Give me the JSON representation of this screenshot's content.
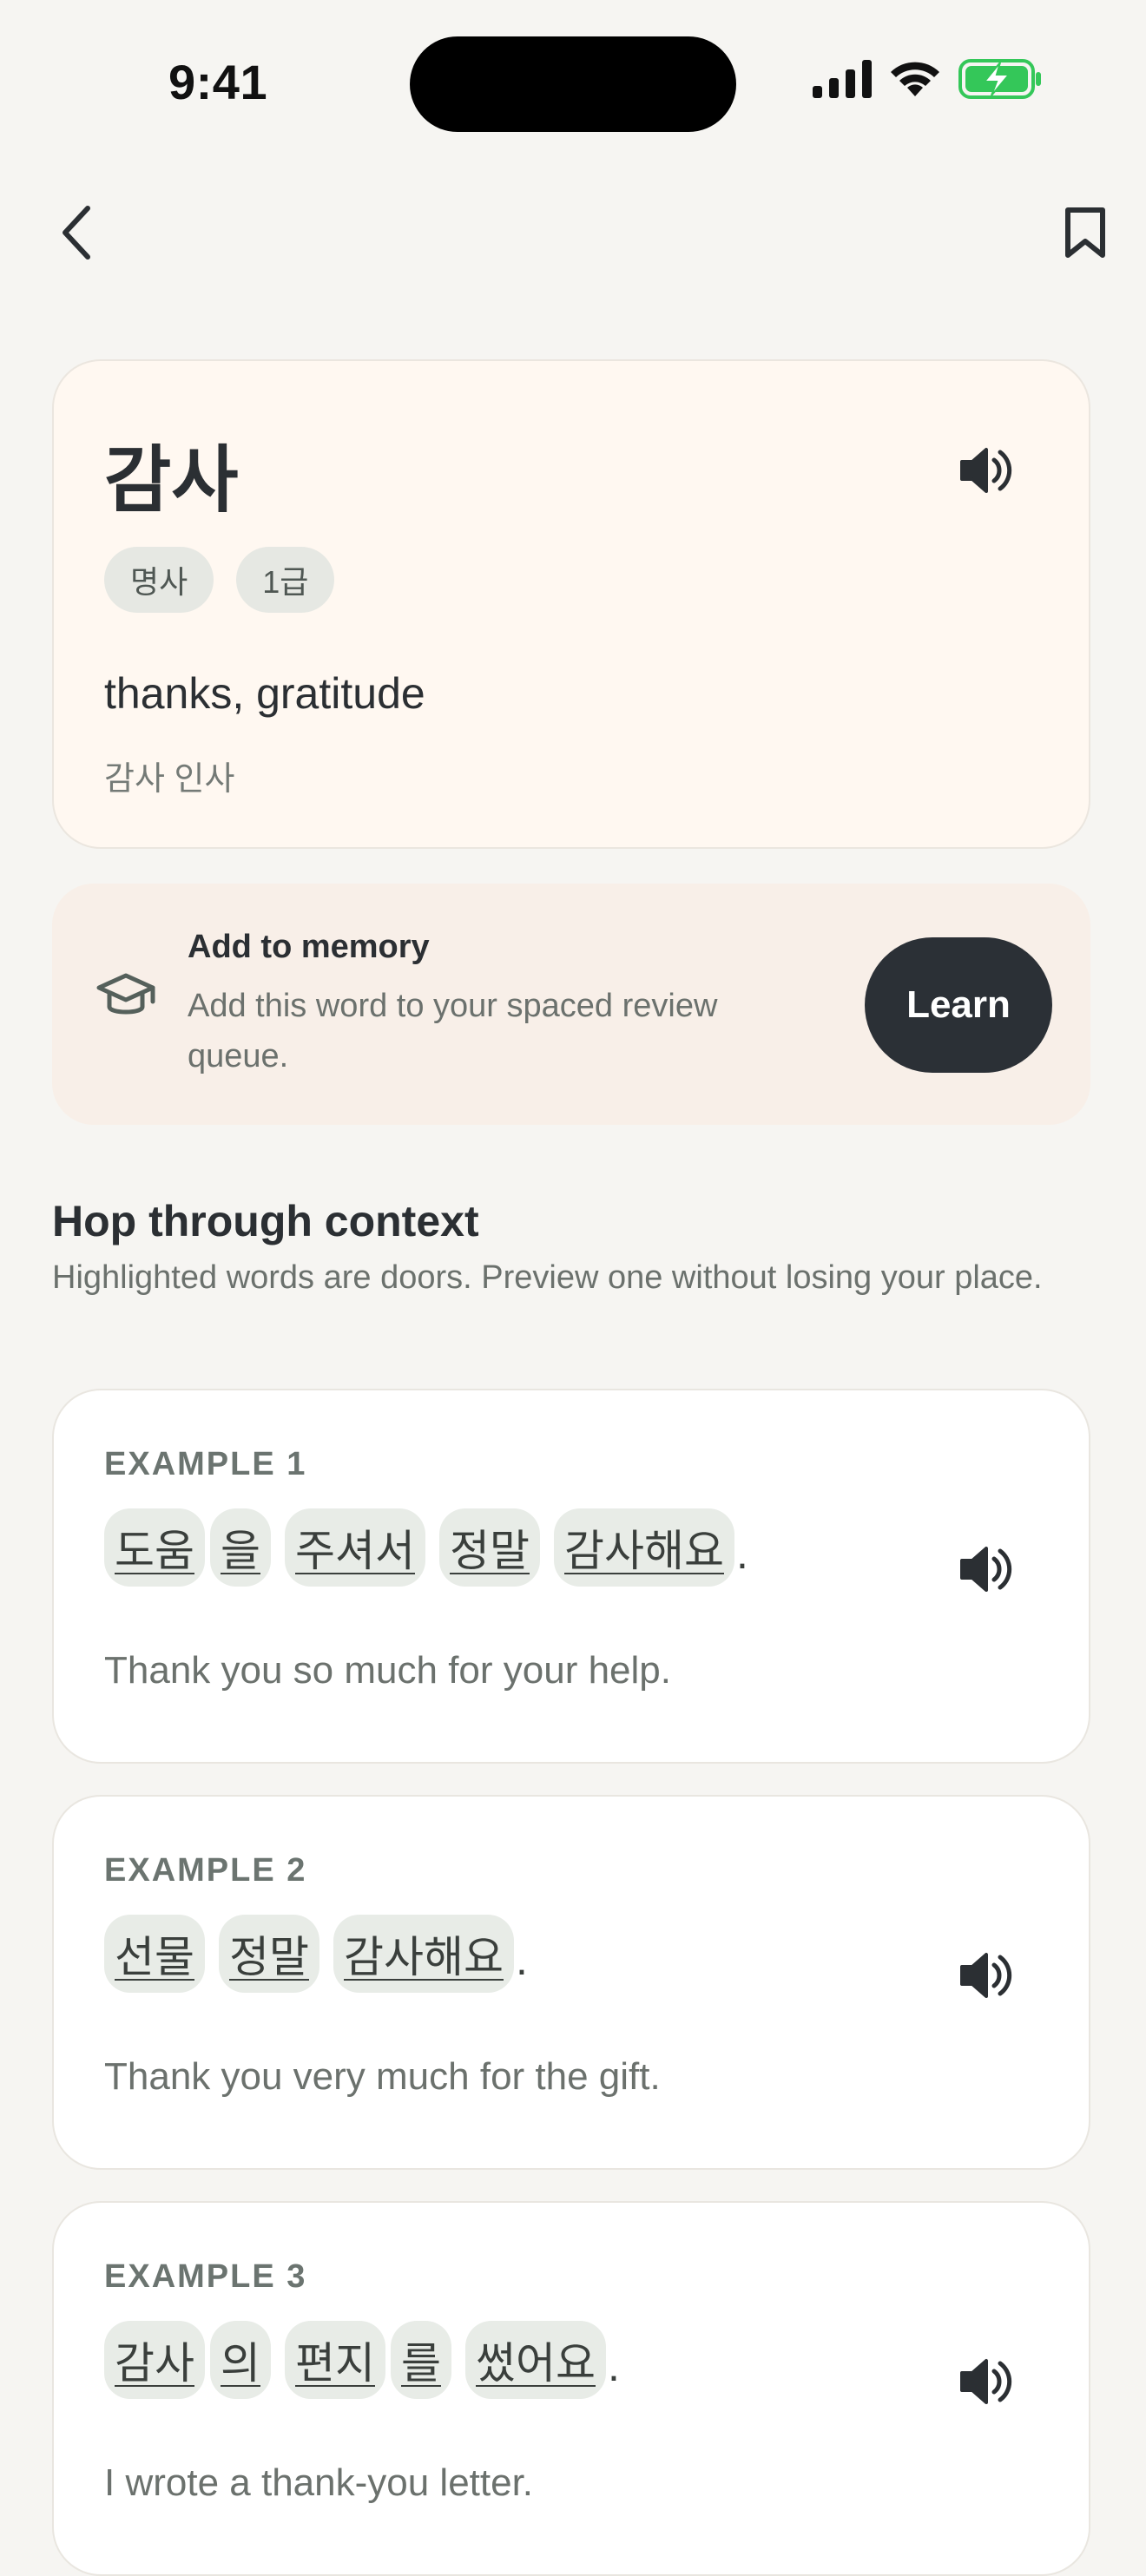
{
  "status_bar": {
    "time": "9:41"
  },
  "nav": {
    "back_icon": "chevron-left-icon",
    "bookmark_icon": "bookmark-icon"
  },
  "word": {
    "headword": "감사",
    "tags": [
      "명사",
      "1급"
    ],
    "meaning": "thanks, gratitude",
    "collocation": "감사 인사"
  },
  "memory": {
    "title": "Add to memory",
    "description": "Add this word to your spaced review queue.",
    "button_label": "Learn",
    "icon": "graduation-cap-icon"
  },
  "context": {
    "title": "Hop through context",
    "description": "Highlighted words are doors. Preview one without losing your place."
  },
  "examples": [
    {
      "label": "EXAMPLE 1",
      "tokens": [
        "도움",
        "을",
        "주셔서",
        "정말",
        "감사해요"
      ],
      "punct": ".",
      "translation": "Thank you so much for your help."
    },
    {
      "label": "EXAMPLE 2",
      "tokens": [
        "선물",
        "정말",
        "감사해요"
      ],
      "punct": ".",
      "translation": "Thank you very much for the gift."
    },
    {
      "label": "EXAMPLE 3",
      "tokens": [
        "감사",
        "의",
        "편지",
        "를",
        "썼어요"
      ],
      "punct": ".",
      "translation": "I wrote a thank-you letter."
    }
  ],
  "colors": {
    "accent_dark": "#2b3036",
    "battery": "#34c759",
    "card_bg": "#fff8f1"
  }
}
